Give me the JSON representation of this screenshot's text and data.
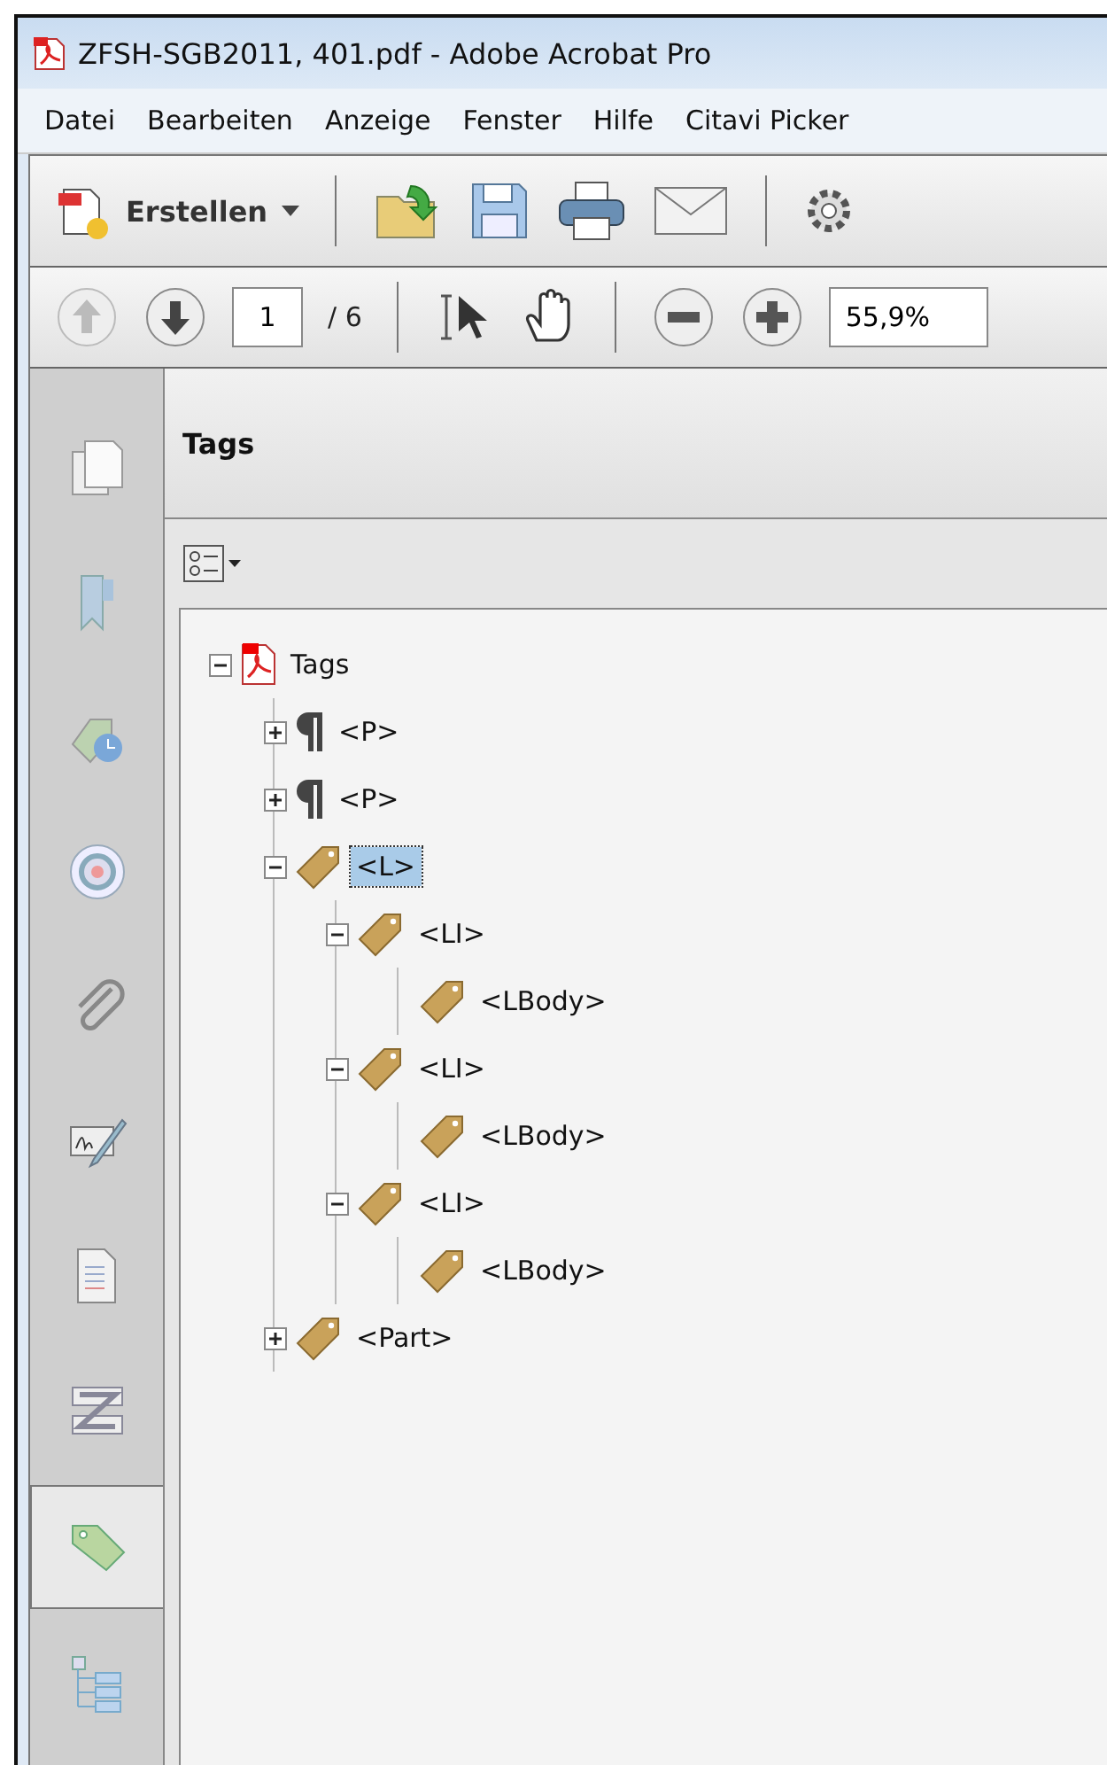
{
  "window": {
    "title": "ZFSH-SGB2011, 401.pdf - Adobe Acrobat Pro"
  },
  "menu": [
    "Datei",
    "Bearbeiten",
    "Anzeige",
    "Fenster",
    "Hilfe",
    "Citavi Picker"
  ],
  "toolbar": {
    "create_label": "Erstellen"
  },
  "navigation": {
    "page": "1",
    "page_total": "/ 6",
    "zoom": "55,9%"
  },
  "sidebar": [
    {
      "kind": "pages",
      "selected": false
    },
    {
      "kind": "bookmarks",
      "selected": false
    },
    {
      "kind": "tagclock",
      "selected": false
    },
    {
      "kind": "target",
      "selected": false
    },
    {
      "kind": "clip",
      "selected": false
    },
    {
      "kind": "sign",
      "selected": false
    },
    {
      "kind": "doc",
      "selected": false
    },
    {
      "kind": "z",
      "selected": false
    },
    {
      "kind": "tag",
      "selected": true
    },
    {
      "kind": "tree",
      "selected": false
    }
  ],
  "panel": {
    "title": "Tags"
  },
  "tree": [
    {
      "label": "Tags",
      "kind": "root",
      "expanded": true,
      "selected": false,
      "children": [
        {
          "label": "<P>",
          "kind": "paragraph",
          "expanded": false,
          "selected": false
        },
        {
          "label": "<P>",
          "kind": "paragraph",
          "expanded": false,
          "selected": false
        },
        {
          "label": "<L>",
          "kind": "tag",
          "expanded": true,
          "selected": true,
          "children": [
            {
              "label": "<LI>",
              "kind": "tag",
              "expanded": true,
              "selected": false,
              "children": [
                {
                  "label": "<LBody>",
                  "kind": "tag",
                  "selected": false
                }
              ]
            },
            {
              "label": "<LI>",
              "kind": "tag",
              "expanded": true,
              "selected": false,
              "children": [
                {
                  "label": "<LBody>",
                  "kind": "tag",
                  "selected": false
                }
              ]
            },
            {
              "label": "<LI>",
              "kind": "tag",
              "expanded": true,
              "selected": false,
              "children": [
                {
                  "label": "<LBody>",
                  "kind": "tag",
                  "selected": false
                }
              ]
            }
          ]
        },
        {
          "label": "<Part>",
          "kind": "tag",
          "expanded": false,
          "selected": false
        }
      ]
    }
  ]
}
